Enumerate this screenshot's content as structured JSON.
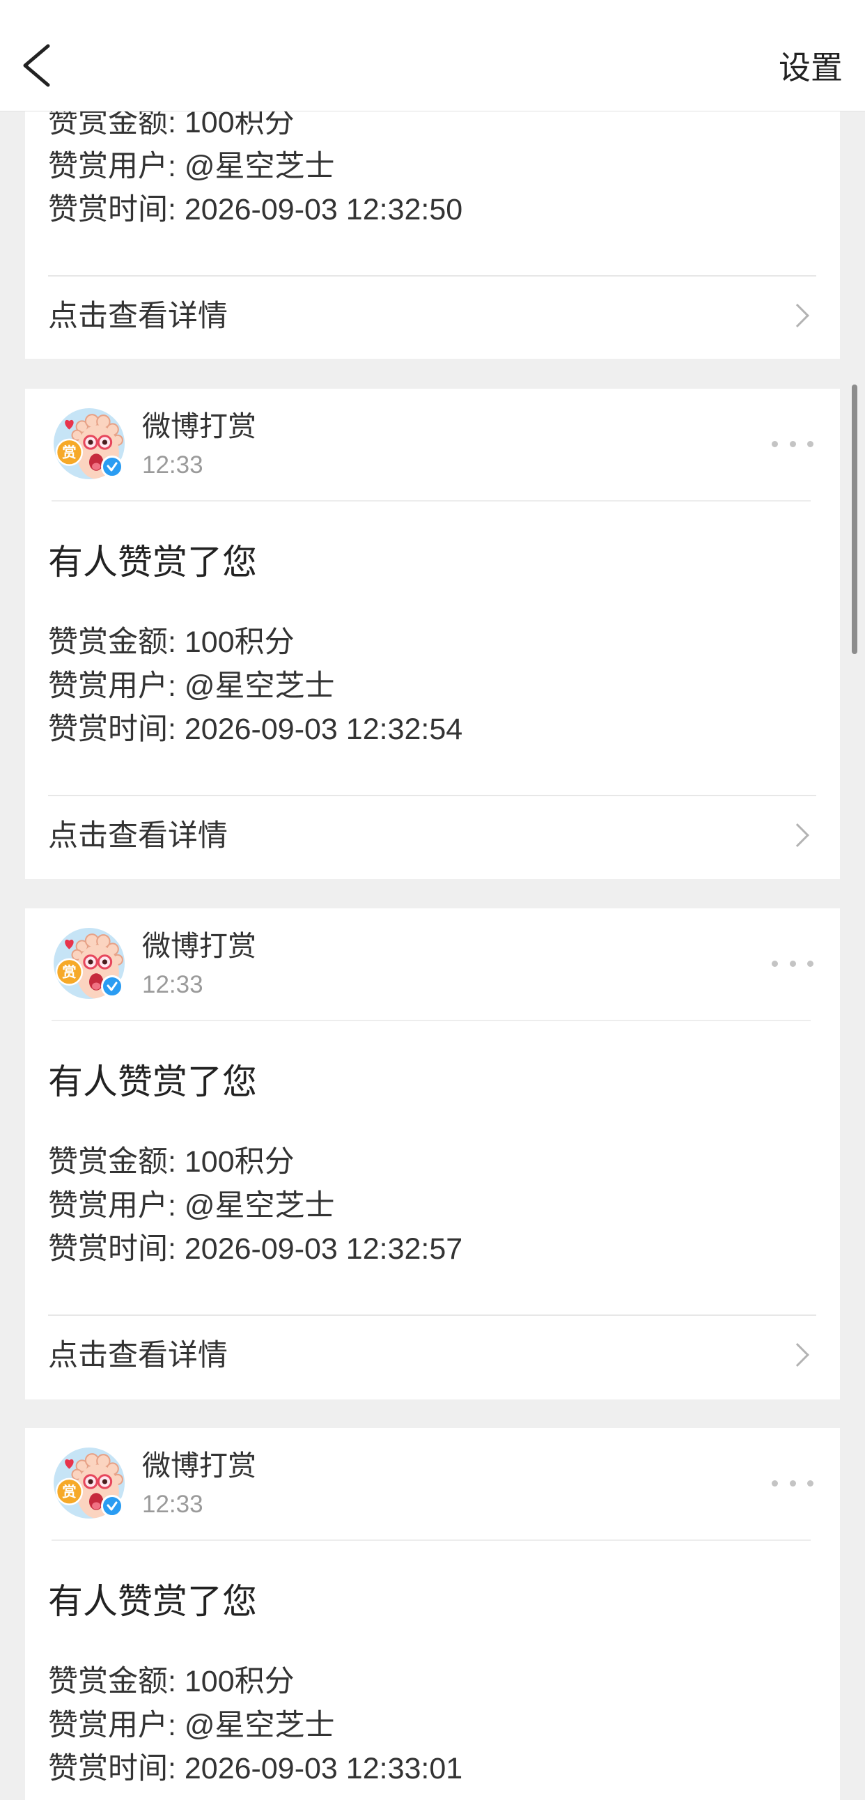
{
  "header": {
    "back_icon": "chevron-left-icon",
    "settings_label": "设置"
  },
  "cards": [
    {
      "details": {
        "amount": "赞赏金额: 100积分",
        "user": "赞赏用户: @星空芝士",
        "time": "赞赏时间: 2026-09-03 12:32:50"
      },
      "link_label": "点击查看详情",
      "link_icon": "chevron-right-icon"
    },
    {
      "sender": {
        "name": "微博打赏",
        "time": "12:33",
        "avatar_badge": "赏",
        "verified_icon": "verified-icon"
      },
      "more_icon": "more-dots-icon",
      "title": "有人赞赏了您",
      "details": {
        "amount": "赞赏金额: 100积分",
        "user": "赞赏用户: @星空芝士",
        "time": "赞赏时间: 2026-09-03 12:32:54"
      },
      "link_label": "点击查看详情",
      "link_icon": "chevron-right-icon"
    },
    {
      "sender": {
        "name": "微博打赏",
        "time": "12:33",
        "avatar_badge": "赏",
        "verified_icon": "verified-icon"
      },
      "more_icon": "more-dots-icon",
      "title": "有人赞赏了您",
      "details": {
        "amount": "赞赏金额: 100积分",
        "user": "赞赏用户: @星空芝士",
        "time": "赞赏时间: 2026-09-03 12:32:57"
      },
      "link_label": "点击查看详情",
      "link_icon": "chevron-right-icon"
    },
    {
      "sender": {
        "name": "微博打赏",
        "time": "12:33",
        "avatar_badge": "赏",
        "verified_icon": "verified-icon"
      },
      "more_icon": "more-dots-icon",
      "title": "有人赞赏了您",
      "details": {
        "amount": "赞赏金额: 100积分",
        "user": "赞赏用户: @星空芝士",
        "time": "赞赏时间: 2026-09-03 12:33:01"
      }
    }
  ],
  "colors": {
    "page_background": "#efefef",
    "card_background": "#ffffff",
    "verified_badge": "#2a9cf2",
    "reward_badge": "#f6a928",
    "secondary_text": "#9a9a9a"
  }
}
